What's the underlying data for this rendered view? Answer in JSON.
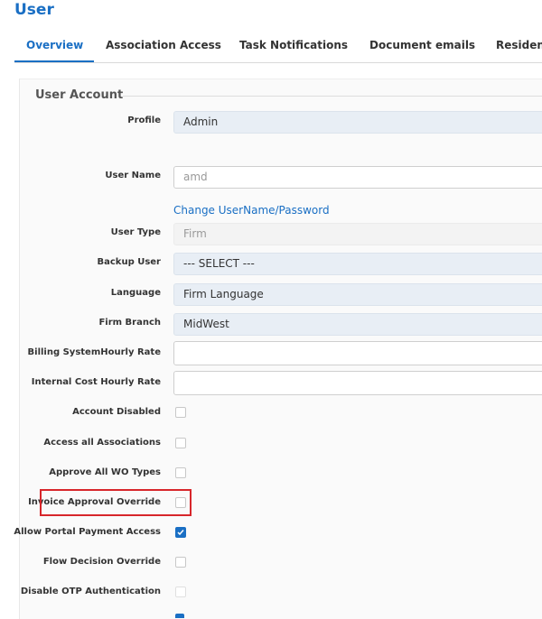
{
  "page": {
    "title": "User"
  },
  "tabs": [
    {
      "label": "Overview",
      "active": true
    },
    {
      "label": "Association Access",
      "active": false
    },
    {
      "label": "Task Notifications",
      "active": false
    },
    {
      "label": "Document emails",
      "active": false
    },
    {
      "label": "Resident",
      "active": false
    }
  ],
  "section": {
    "title": "User Account"
  },
  "fields": {
    "profile": {
      "label": "Profile",
      "value": "Admin"
    },
    "user_name": {
      "label": "User Name",
      "value": "amd"
    },
    "change_link": "Change UserName/Password",
    "user_type": {
      "label": "User Type",
      "value": "Firm"
    },
    "backup_user": {
      "label": "Backup User",
      "value": "--- SELECT ---"
    },
    "language": {
      "label": "Language",
      "value": "Firm Language"
    },
    "firm_branch": {
      "label": "Firm Branch",
      "value": "MidWest"
    },
    "billing_rate": {
      "label": "Billing SystemHourly Rate",
      "value": ""
    },
    "internal_rate": {
      "label": "Internal Cost Hourly Rate",
      "value": ""
    }
  },
  "checkboxes": [
    {
      "label": "Account Disabled",
      "checked": false
    },
    {
      "label": "Access all Associations",
      "checked": false
    },
    {
      "label": "Approve All WO Types",
      "checked": false
    },
    {
      "label": "Invoice Approval Override",
      "checked": false
    },
    {
      "label": "Allow Portal Payment Access",
      "checked": true
    },
    {
      "label": "Flow Decision Override",
      "checked": false
    },
    {
      "label": "Disable OTP Authentication",
      "checked": false
    }
  ],
  "colors": {
    "accent": "#1a6fc4",
    "highlight": "#d7262b"
  }
}
